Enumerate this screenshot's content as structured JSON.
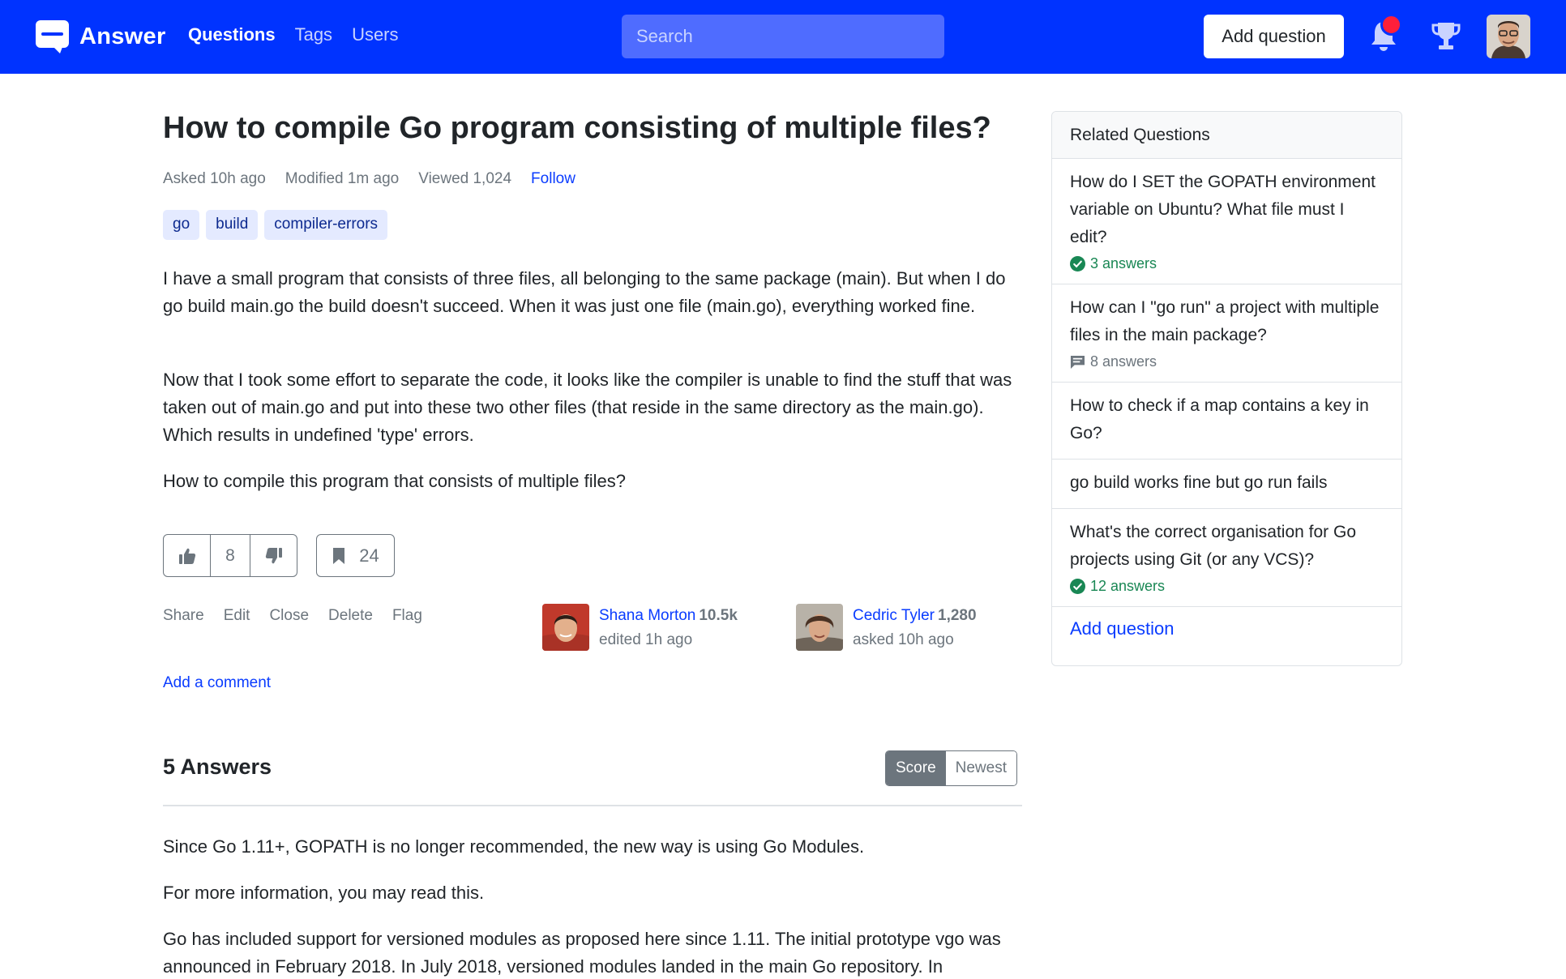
{
  "header": {
    "brand": "Answer",
    "nav": [
      "Questions",
      "Tags",
      "Users"
    ],
    "search_placeholder": "Search",
    "add_question": "Add question",
    "colors": {
      "bar": "#0033ff",
      "badge": "#ff1f3a"
    }
  },
  "question": {
    "title": "How to compile Go program consisting of multiple files?",
    "asked": "Asked 10h ago",
    "modified": "Modified 1m ago",
    "viewed": "Viewed 1,024",
    "follow": "Follow",
    "tags": [
      "go",
      "build",
      "compiler-errors"
    ],
    "paragraphs": [
      "I have a small program that consists of three files, all belonging to the same package (main). But when I do go build main.go the build doesn't succeed. When it was just one file (main.go), everything worked fine.",
      "Now that I took some effort to separate the code, it looks like the compiler is unable to find the stuff that was taken out of main.go and put into these two other files (that reside in the same directory as the main.go). Which results in undefined 'type' errors.",
      "How to compile this program that consists of multiple files?"
    ],
    "votes": "8",
    "bookmarks": "24",
    "actions": [
      "Share",
      "Edit",
      "Close",
      "Delete",
      "Flag"
    ],
    "editor": {
      "name": "Shana Morton",
      "rep": "10.5k",
      "when": "edited 1h ago"
    },
    "asker": {
      "name": "Cedric Tyler",
      "rep": "1,280",
      "when": "asked 10h ago"
    },
    "add_comment": "Add a comment"
  },
  "answers": {
    "title": "5 Answers",
    "sort": [
      "Score",
      "Newest"
    ],
    "first_answer": [
      "Since Go 1.11+, GOPATH is no longer recommended, the new way is using Go Modules.",
      "For more information, you may read this.",
      "Go has included support for versioned modules as proposed here since 1.11. The initial prototype vgo was announced in February 2018. In July 2018, versioned modules landed in the main Go repository. In"
    ]
  },
  "sidebar": {
    "title": "Related Questions",
    "items": [
      {
        "q": "How do I SET the GOPATH environment variable on Ubuntu? What file must I edit?",
        "answers": "3 answers",
        "accepted": true
      },
      {
        "q": "How can I \"go run\" a project with multiple files in the main package?",
        "answers": "8 answers",
        "accepted": false
      },
      {
        "q": "How to check if a map contains a key in Go?",
        "answers": "",
        "accepted": false
      },
      {
        "q": "go build works fine but go run fails",
        "answers": "",
        "accepted": false
      },
      {
        "q": "What's the correct organisation for Go projects using Git (or any VCS)?",
        "answers": "12 answers",
        "accepted": true
      }
    ],
    "add_question": "Add question"
  }
}
